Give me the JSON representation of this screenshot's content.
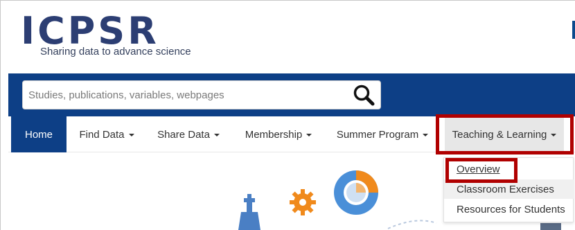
{
  "header": {
    "logo_text": "ICPSR",
    "tagline": "Sharing data to advance science"
  },
  "search": {
    "placeholder": "Studies, publications, variables, webpages",
    "button_icon": "search-icon"
  },
  "nav": {
    "items": [
      {
        "label": "Home",
        "has_caret": false,
        "active": true
      },
      {
        "label": "Find Data",
        "has_caret": true
      },
      {
        "label": "Share Data",
        "has_caret": true
      },
      {
        "label": "Membership",
        "has_caret": true
      },
      {
        "label": "Summer Program",
        "has_caret": true
      },
      {
        "label": "Teaching & Learning",
        "has_caret": true,
        "open": true
      }
    ]
  },
  "dropdown": {
    "items": [
      {
        "label": "Overview"
      },
      {
        "label": "Classroom Exercises"
      },
      {
        "label": "Resources for Students"
      }
    ]
  },
  "colors": {
    "brand_navy": "#0d3f86",
    "logo_color": "#2c3e73",
    "highlight_red": "#b00000",
    "accent_orange": "#f08a1c",
    "accent_blue": "#4a8fd8"
  }
}
